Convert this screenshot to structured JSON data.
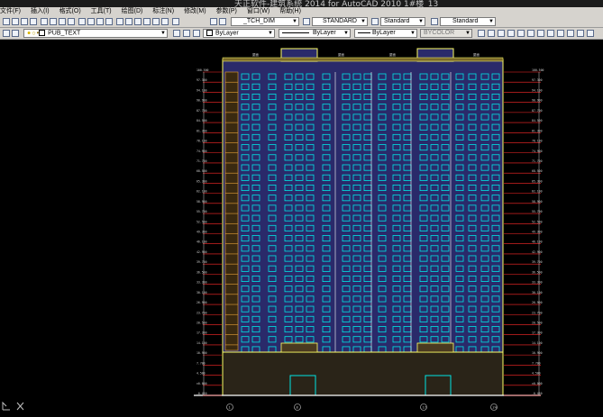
{
  "app": {
    "title": "天正软件-建筑系统 2014 for AutoCAD 2010    1#楼_13"
  },
  "menubar": {
    "items": [
      "文件(F)",
      "插入(I)",
      "格式(O)",
      "工具(T)",
      "绘图(D)",
      "标注(N)",
      "修改(M)",
      "参数(P)",
      "窗口(W)",
      "帮助(H)"
    ]
  },
  "toolbar1": {
    "dim_style": "_TCH_DIM",
    "text_style": "STANDARD",
    "table_style": "Standard",
    "multileader_style": "Standard"
  },
  "toolbar2": {
    "layer": "PUB_TEXT",
    "color": "ByLayer",
    "linetype": "ByLayer",
    "lineweight": "ByLayer",
    "plot_style": "BYCOLOR"
  },
  "drawing": {
    "left_elevation_labels": [
      "100.500",
      "97.300",
      "94.100",
      "90.900",
      "87.700",
      "84.500",
      "81.300",
      "78.100",
      "74.900",
      "71.700",
      "68.500",
      "65.300",
      "62.100",
      "58.900",
      "55.700",
      "52.500",
      "49.300",
      "46.100",
      "42.900",
      "39.700",
      "36.500",
      "33.300",
      "30.100",
      "26.900",
      "23.700",
      "20.500",
      "17.300",
      "14.100",
      "10.900",
      "7.700",
      "4.500",
      "±0.000",
      "-0.450"
    ],
    "right_elevation_labels": [
      "100.500",
      "97.300",
      "94.100",
      "90.900",
      "87.700",
      "84.500",
      "81.300",
      "78.100",
      "74.900",
      "71.700",
      "68.500",
      "65.300",
      "62.100",
      "58.900",
      "55.700",
      "52.500",
      "49.300",
      "46.100",
      "42.900",
      "39.700",
      "36.500",
      "33.300",
      "30.100",
      "26.900",
      "23.700",
      "20.500",
      "17.300",
      "14.100",
      "10.900",
      "7.700",
      "4.500",
      "±0.000",
      "-0.450"
    ],
    "top_labels": [
      "屋面",
      "屋面",
      "屋面",
      "屋面"
    ],
    "bottom_axis_labels": [
      "1",
      "8",
      "17",
      "24"
    ]
  },
  "colors": {
    "background": "#000000",
    "facade_outline": "#ffff66",
    "window": "#00e5e5",
    "wall": "#2a2a6a",
    "elevation_line": "#ff2a2a",
    "balcony": "#e8a23a",
    "dim_text": "#d0d0d0",
    "menubar": "#d6d3ce"
  },
  "icons": {
    "ucs": "ucs-axis-icon"
  }
}
